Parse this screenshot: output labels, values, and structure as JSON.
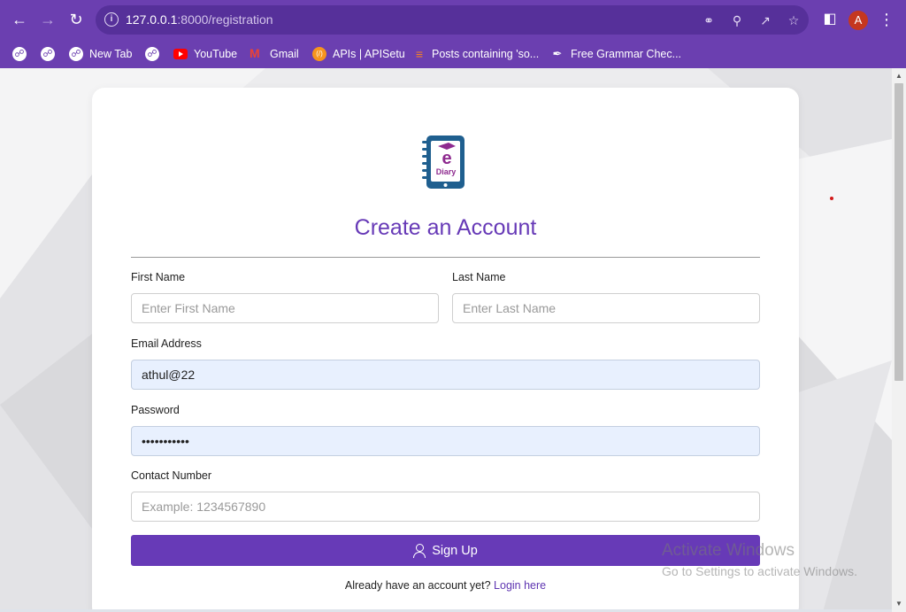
{
  "browser": {
    "url_host": "127.0.0.1",
    "url_path": ":8000/registration",
    "avatar_letter": "A",
    "bookmarks": [
      {
        "label": "",
        "icon": "globe-icon"
      },
      {
        "label": "",
        "icon": "globe-icon"
      },
      {
        "label": "New Tab",
        "icon": "globe-icon"
      },
      {
        "label": "",
        "icon": "globe-icon"
      },
      {
        "label": "YouTube",
        "icon": "youtube-icon"
      },
      {
        "label": "Gmail",
        "icon": "gmail-icon"
      },
      {
        "label": "APIs | APISetu",
        "icon": "apisetu-icon"
      },
      {
        "label": "Posts containing 'so...",
        "icon": "stackoverflow-icon"
      },
      {
        "label": "Free Grammar Chec...",
        "icon": "quill-icon"
      }
    ]
  },
  "logo": {
    "top_text": "e",
    "bottom_text": "Diary"
  },
  "form": {
    "title": "Create an Account",
    "first_name": {
      "label": "First Name",
      "placeholder": "Enter First Name",
      "value": ""
    },
    "last_name": {
      "label": "Last Name",
      "placeholder": "Enter Last Name",
      "value": ""
    },
    "email": {
      "label": "Email Address",
      "value": "athul@22"
    },
    "password": {
      "label": "Password",
      "value": "•••••••••••"
    },
    "contact": {
      "label": "Contact Number",
      "placeholder": "Example: 1234567890",
      "value": ""
    },
    "submit_label": "Sign Up",
    "login_prompt": "Already have an account yet?",
    "login_link": "Login here"
  },
  "watermark": {
    "line1": "Activate Windows",
    "line2": "Go to Settings to activate Windows."
  },
  "colors": {
    "accent": "#673ab7",
    "chrome": "#6b3fb0"
  }
}
